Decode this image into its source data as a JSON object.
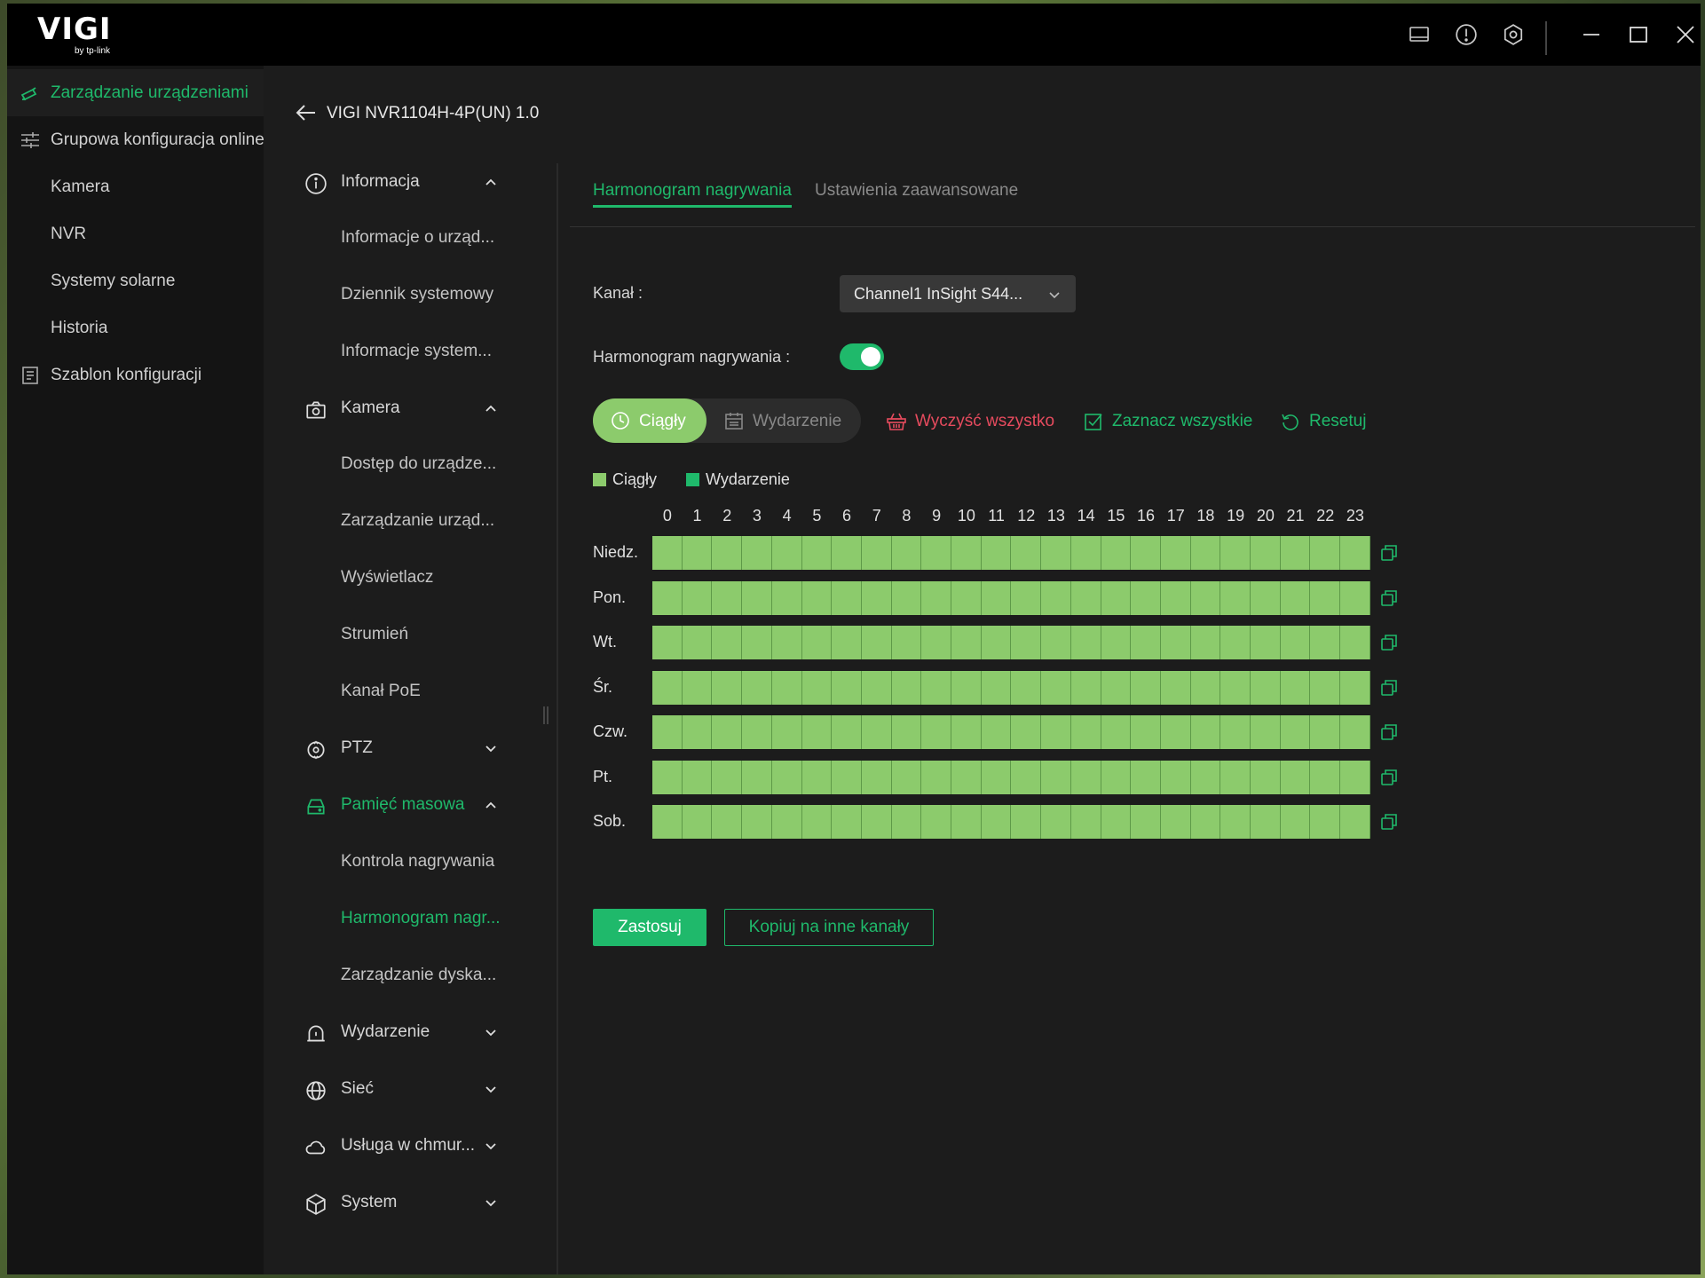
{
  "colors": {
    "accent": "#1fb96b",
    "continuous": "#8ccb6c",
    "event": "#1fb96b",
    "danger": "#e64b5e"
  },
  "app": {
    "logo": "VIGI",
    "logo_sub": "by tp-link"
  },
  "titlebar_icons": [
    "screen-icon",
    "alert-icon",
    "settings-icon",
    "minimize-icon",
    "maximize-icon",
    "close-icon"
  ],
  "sidebar": {
    "items": [
      {
        "label": "Zarządzanie urządzeniami",
        "icon": "device-management-icon",
        "active": true
      },
      {
        "label": "Grupowa konfiguracja online",
        "icon": "sliders-icon"
      },
      {
        "label": "Kamera"
      },
      {
        "label": "NVR"
      },
      {
        "label": "Systemy solarne"
      },
      {
        "label": "Historia"
      },
      {
        "label": "Szablon konfiguracji",
        "icon": "template-icon"
      }
    ]
  },
  "device": {
    "title": "VIGI NVR1104H-4P(UN) 1.0"
  },
  "nav": {
    "informacja": {
      "label": "Informacja",
      "subs": [
        "Informacje o urząd...",
        "Dziennik systemowy",
        "Informacje system..."
      ]
    },
    "kamera": {
      "label": "Kamera",
      "subs": [
        "Dostęp do urządze...",
        "Zarządzanie urząd...",
        "Wyświetlacz",
        "Strumień",
        "Kanał PoE"
      ]
    },
    "ptz": {
      "label": "PTZ"
    },
    "pamiec": {
      "label": "Pamięć masowa",
      "subs": [
        "Kontrola nagrywania",
        "Harmonogram nagr...",
        "Zarządzanie dyska..."
      ]
    },
    "wydarzenie": {
      "label": "Wydarzenie"
    },
    "siec": {
      "label": "Sieć"
    },
    "chmura": {
      "label": "Usługa w chmur..."
    },
    "system": {
      "label": "System"
    }
  },
  "tabs": [
    {
      "label": "Harmonogram nagrywania",
      "active": true
    },
    {
      "label": "Ustawienia zaawansowane"
    }
  ],
  "form": {
    "channel_label": "Kanał :",
    "channel_value": "Channel1 InSight S44...",
    "schedule_label": "Harmonogram nagrywania :",
    "schedule_enabled": true
  },
  "mode": {
    "continuous": "Ciągły",
    "event": "Wydarzenie",
    "selected": "Ciągły"
  },
  "actions": {
    "clear_all": "Wyczyść wszystko",
    "select_all": "Zaznacz wszystkie",
    "reset": "Resetuj"
  },
  "legend": {
    "continuous": "Ciągły",
    "event": "Wydarzenie"
  },
  "hours": [
    "0",
    "1",
    "2",
    "3",
    "4",
    "5",
    "6",
    "7",
    "8",
    "9",
    "10",
    "11",
    "12",
    "13",
    "14",
    "15",
    "16",
    "17",
    "18",
    "19",
    "20",
    "21",
    "22",
    "23"
  ],
  "days": [
    {
      "label": "Niedz.",
      "continuous_hours": 24
    },
    {
      "label": "Pon.",
      "continuous_hours": 24
    },
    {
      "label": "Wt.",
      "continuous_hours": 24
    },
    {
      "label": "Śr.",
      "continuous_hours": 24
    },
    {
      "label": "Czw.",
      "continuous_hours": 24
    },
    {
      "label": "Pt.",
      "continuous_hours": 24
    },
    {
      "label": "Sob.",
      "continuous_hours": 24
    }
  ],
  "buttons": {
    "apply": "Zastosuj",
    "copy": "Kopiuj na inne kanały"
  }
}
